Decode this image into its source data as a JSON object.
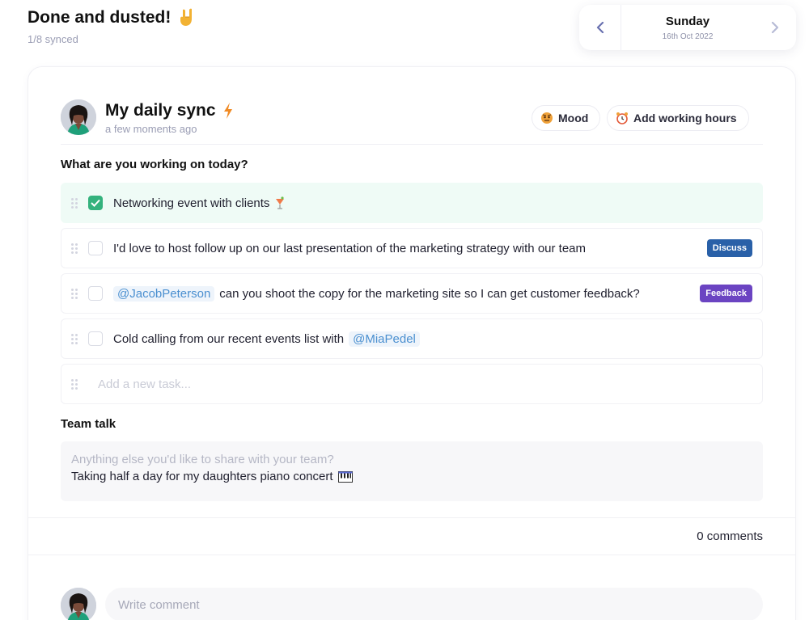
{
  "header": {
    "title": "Done and dusted!",
    "subtitle": "1/8 synced"
  },
  "date": {
    "day": "Sunday",
    "full": "16th Oct 2022"
  },
  "sync": {
    "title": "My daily sync",
    "time": "a few moments ago",
    "mood_label": "Mood",
    "hours_label": "Add working hours"
  },
  "tasks": {
    "heading": "What are you working on today?",
    "items": [
      {
        "text": "Networking event with clients",
        "done": true
      },
      {
        "text": "I'd love to host follow up on our last presentation of the marketing strategy with our team",
        "done": false,
        "tag": "Discuss"
      },
      {
        "mention": "@JacobPeterson",
        "text": "can you shoot the copy for the marketing site so I can get customer feedback?",
        "done": false,
        "tag": "Feedback"
      },
      {
        "text": "Cold calling from our recent events list with",
        "mention": "@MiaPedel",
        "done": false
      }
    ],
    "add_placeholder": "Add a new task..."
  },
  "team": {
    "heading": "Team talk",
    "placeholder": "Anything else you'd like to share with your team?",
    "text": "Taking half a day for my daughters piano concert"
  },
  "comments": {
    "count_label": "0 comments",
    "placeholder": "Write comment"
  },
  "colors": {
    "accent_green": "#34b27d",
    "discuss_tag": "#2960a8",
    "feedback_tag": "#6b44c2",
    "mention": "#4a8fd0"
  },
  "icons": {
    "header": "rock-on-hand-icon",
    "sync": "lightning-icon",
    "mood": "mood-face-icon",
    "hours": "alarm-clock-icon",
    "task1": "cocktail-icon",
    "team": "piano-icon"
  }
}
